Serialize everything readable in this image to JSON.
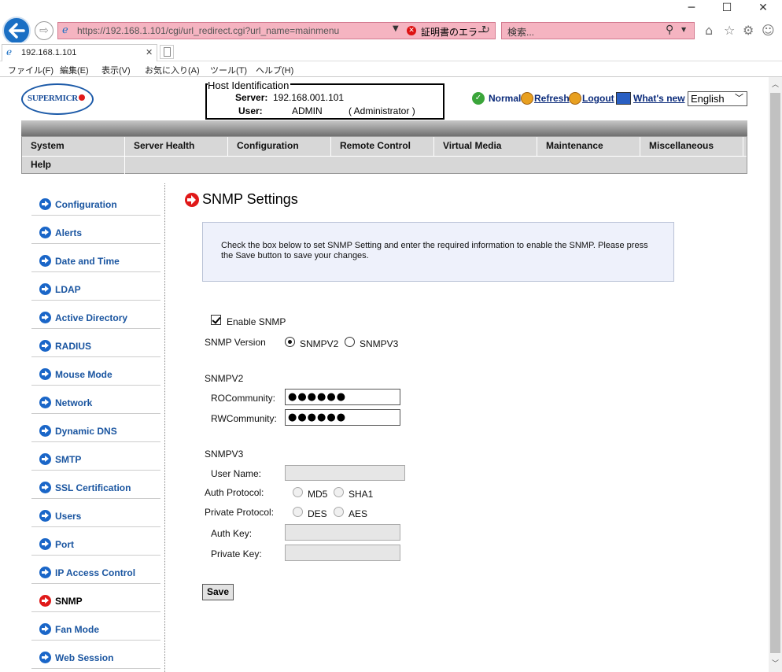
{
  "browser": {
    "url": "https://192.168.1.101/cgi/url_redirect.cgi?url_name=mainmenu",
    "cert_error": "証明書のエラー",
    "search_placeholder": "検索...",
    "tab_title": "192.168.1.101",
    "menu": [
      "ファイル(F)",
      "編集(E)",
      "表示(V)",
      "お気に入り(A)",
      "ツール(T)",
      "ヘルプ(H)"
    ]
  },
  "header": {
    "logo_text": "SUPERMICR",
    "host_legend": "Host Identification",
    "server_label": "Server:",
    "server_value": "192.168.001.101",
    "user_label": "User:",
    "user_value": "ADMIN",
    "user_role": "( Administrator )",
    "links": {
      "normal": "Normal",
      "refresh": "Refresh",
      "logout": "Logout",
      "whats_new": "What's new"
    },
    "language": "English"
  },
  "nav": {
    "row1": [
      "System",
      "Server Health",
      "Configuration",
      "Remote Control",
      "Virtual Media",
      "Maintenance",
      "Miscellaneous"
    ],
    "row2": [
      "Help"
    ]
  },
  "sidebar": {
    "items": [
      "Configuration",
      "Alerts",
      "Date and Time",
      "LDAP",
      "Active Directory",
      "RADIUS",
      "Mouse Mode",
      "Network",
      "Dynamic DNS",
      "SMTP",
      "SSL Certification",
      "Users",
      "Port",
      "IP Access Control",
      "SNMP",
      "Fan Mode",
      "Web Session"
    ],
    "active": "SNMP"
  },
  "page": {
    "title": "SNMP Settings",
    "info": "Check the box below to set SNMP Setting and enter the required information to enable the SNMP. Please press the Save button to save your changes.",
    "enable_label": "Enable SNMP",
    "version_label": "SNMP Version",
    "v2_option": "SNMPV2",
    "v3_option": "SNMPV3",
    "v2_heading": "SNMPV2",
    "ro_label": "ROCommunity:",
    "ro_value": "●●●●●●",
    "rw_label": "RWCommunity:",
    "rw_value": "●●●●●●",
    "v3_heading": "SNMPV3",
    "username_label": "User Name:",
    "auth_protocol_label": "Auth Protocol:",
    "md5": "MD5",
    "sha1": "SHA1",
    "priv_protocol_label": "Private Protocol:",
    "des": "DES",
    "aes": "AES",
    "auth_key_label": "Auth Key:",
    "priv_key_label": "Private Key:",
    "save_label": "Save"
  }
}
